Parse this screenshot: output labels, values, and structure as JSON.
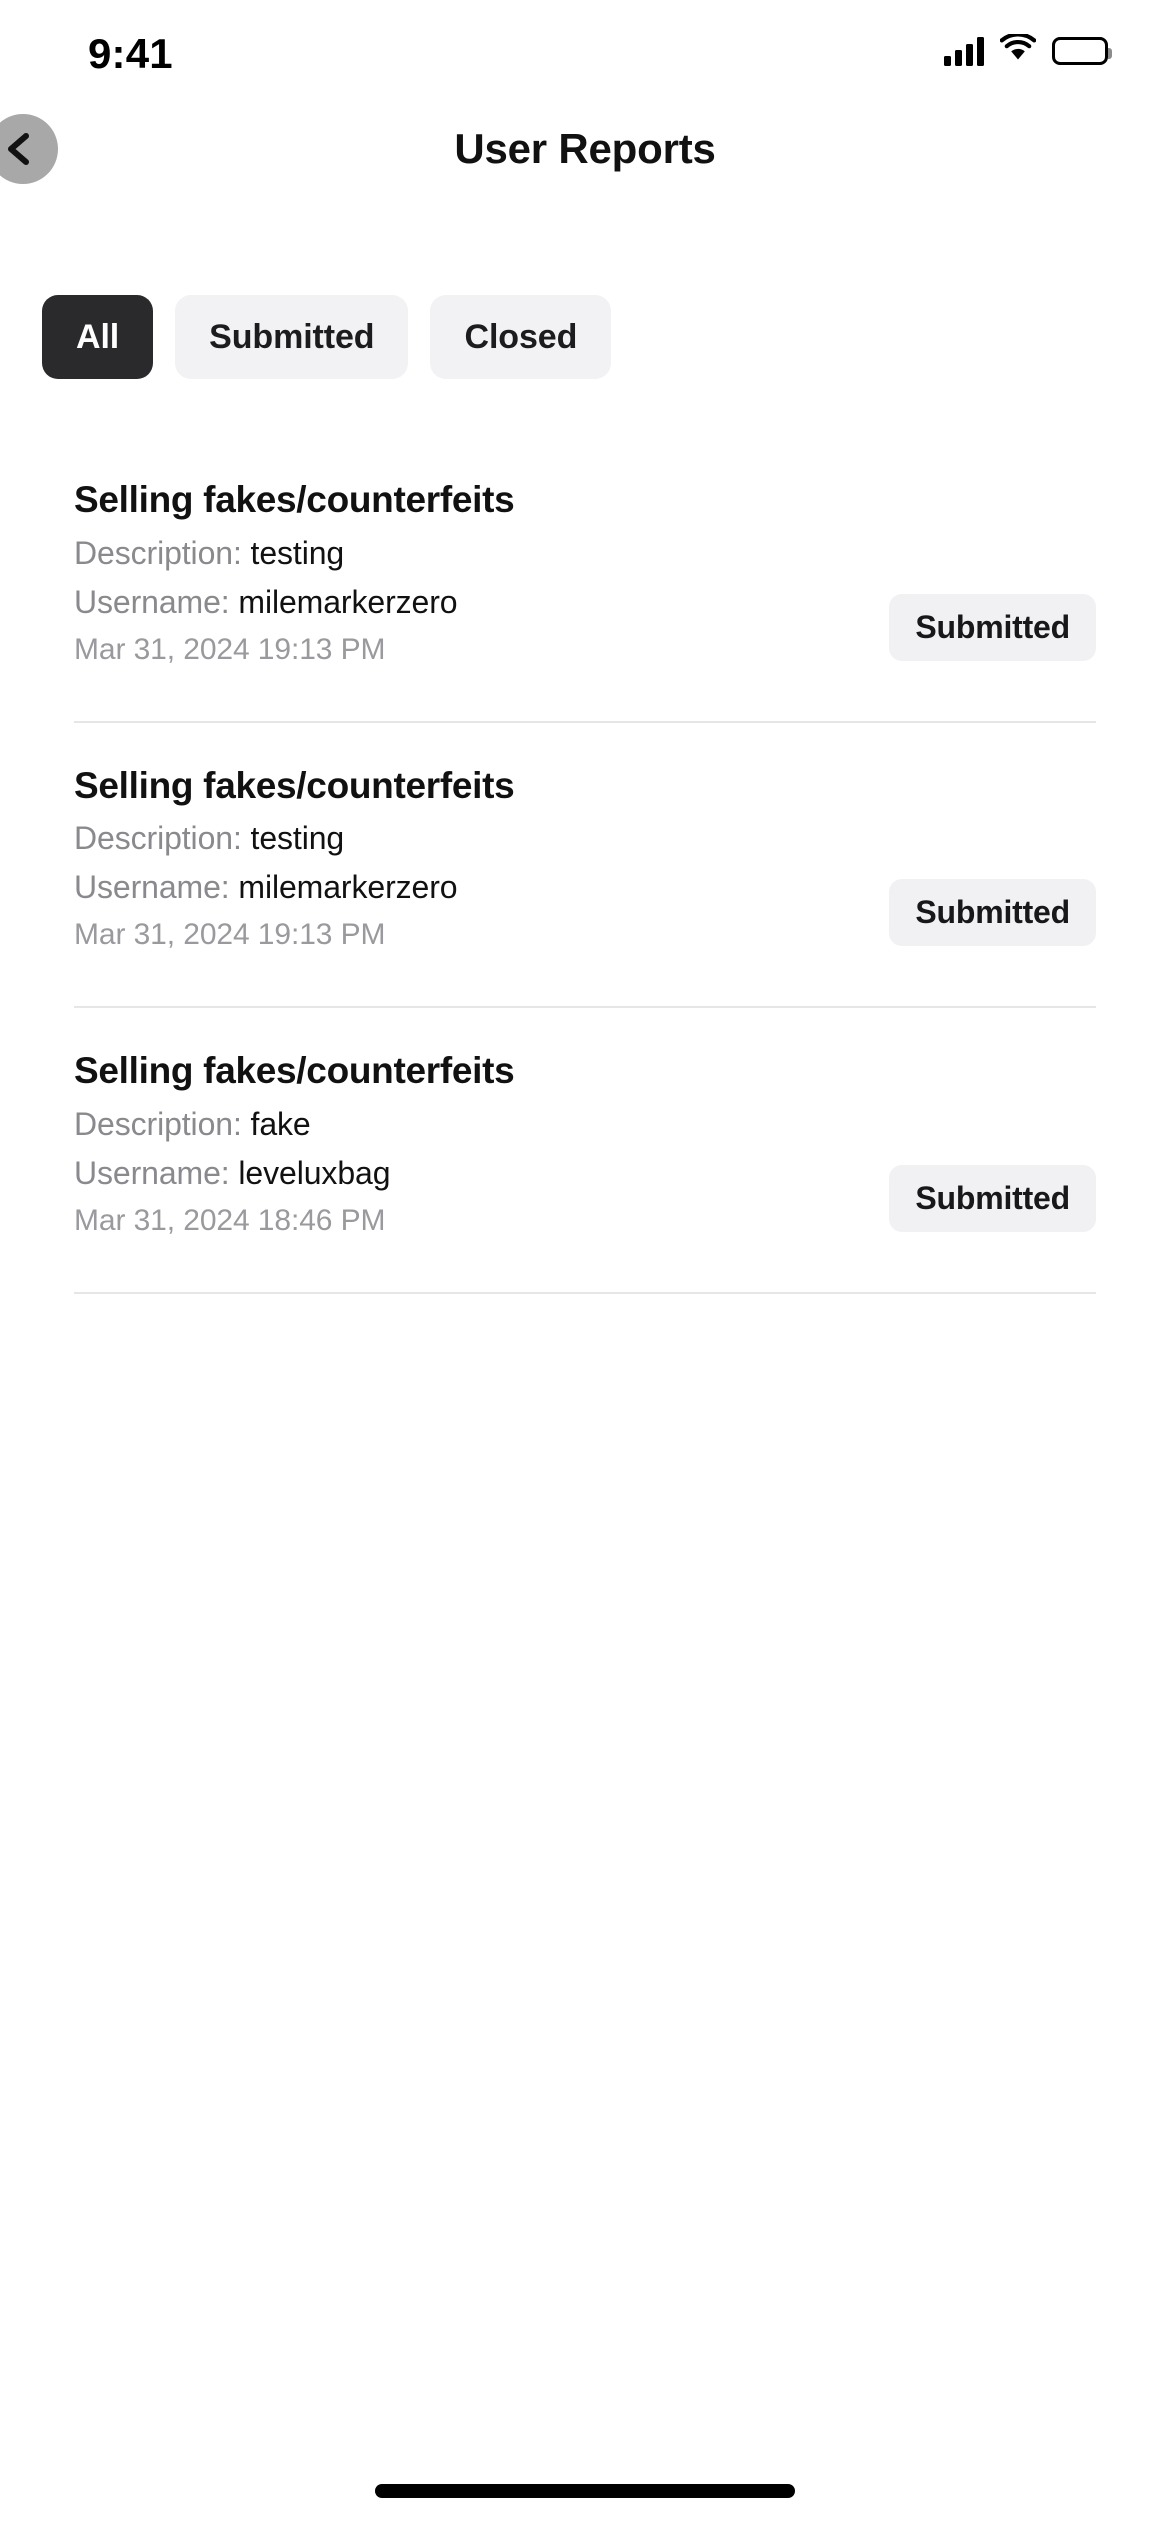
{
  "status_bar": {
    "time": "9:41",
    "icons": [
      "cellular-signal-icon",
      "wifi-icon",
      "battery-icon"
    ]
  },
  "header": {
    "title": "User Reports",
    "back_icon": "chevron-left-icon"
  },
  "filters": {
    "tabs": [
      {
        "label": "All",
        "active": true
      },
      {
        "label": "Submitted",
        "active": false
      },
      {
        "label": "Closed",
        "active": false
      }
    ]
  },
  "labels": {
    "description": "Description:",
    "username": "Username:"
  },
  "reports": [
    {
      "title": "Selling fakes/counterfeits",
      "description": "testing",
      "username": "milemarkerzero",
      "timestamp": "Mar 31, 2024 19:13 PM",
      "status": "Submitted"
    },
    {
      "title": "Selling fakes/counterfeits",
      "description": "testing",
      "username": "milemarkerzero",
      "timestamp": "Mar 31, 2024 19:13 PM",
      "status": "Submitted"
    },
    {
      "title": "Selling fakes/counterfeits",
      "description": "fake",
      "username": "leveluxbag",
      "timestamp": "Mar 31, 2024 18:46 PM",
      "status": "Submitted"
    }
  ],
  "colors": {
    "active_tab_bg": "#2a2a2c",
    "inactive_tab_bg": "#f2f2f4",
    "badge_bg": "#f1f1f3",
    "label_gray": "#8a8a8e",
    "meta_gray": "#9a9a9e",
    "divider": "#e6e6e8",
    "back_circle": "#a8a8a8"
  }
}
